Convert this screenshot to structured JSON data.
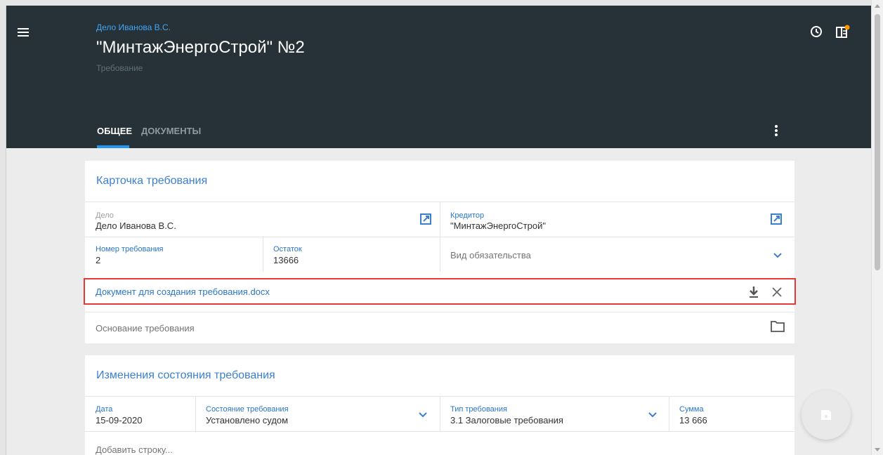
{
  "header": {
    "breadcrumb": "Дело Иванова В.С.",
    "title": "\"МинтажЭнергоСтрой\" №2",
    "subtitle": "Требование",
    "icons": [
      "menu-icon",
      "clock-icon",
      "side-panel-icon"
    ]
  },
  "tabs": [
    {
      "label": "Общее",
      "active": true
    },
    {
      "label": "Документы",
      "active": false
    }
  ],
  "card_claim": {
    "title": "Карточка требования",
    "case_label": "Дело",
    "case_value": "Дело Иванова В.С.",
    "creditor_label": "Кредитор",
    "creditor_value": "\"МинтажЭнергоСтрой\"",
    "number_label": "Номер требования",
    "number_value": "2",
    "balance_label": "Остаток",
    "balance_value": "13666",
    "obligation_placeholder": "Вид обязательства",
    "document_name": "Документ для создания требования.docx",
    "basis_placeholder": "Основание требования"
  },
  "card_status": {
    "title": "Изменения состояния требования",
    "date_label": "Дата",
    "date_value": "15-09-2020",
    "state_label": "Состояние требования",
    "state_value": "Установлено судом",
    "type_label": "Тип требования",
    "type_value": "3.1 Залоговые требования",
    "sum_label": "Сумма",
    "sum_value": "13 666",
    "add_row": "Добавить строку..."
  },
  "colors": {
    "header_bg": "#263238",
    "accent": "#2196f3",
    "link": "#2a76c6",
    "highlight_border": "#e53935",
    "notification_dot": "#ff9800"
  }
}
